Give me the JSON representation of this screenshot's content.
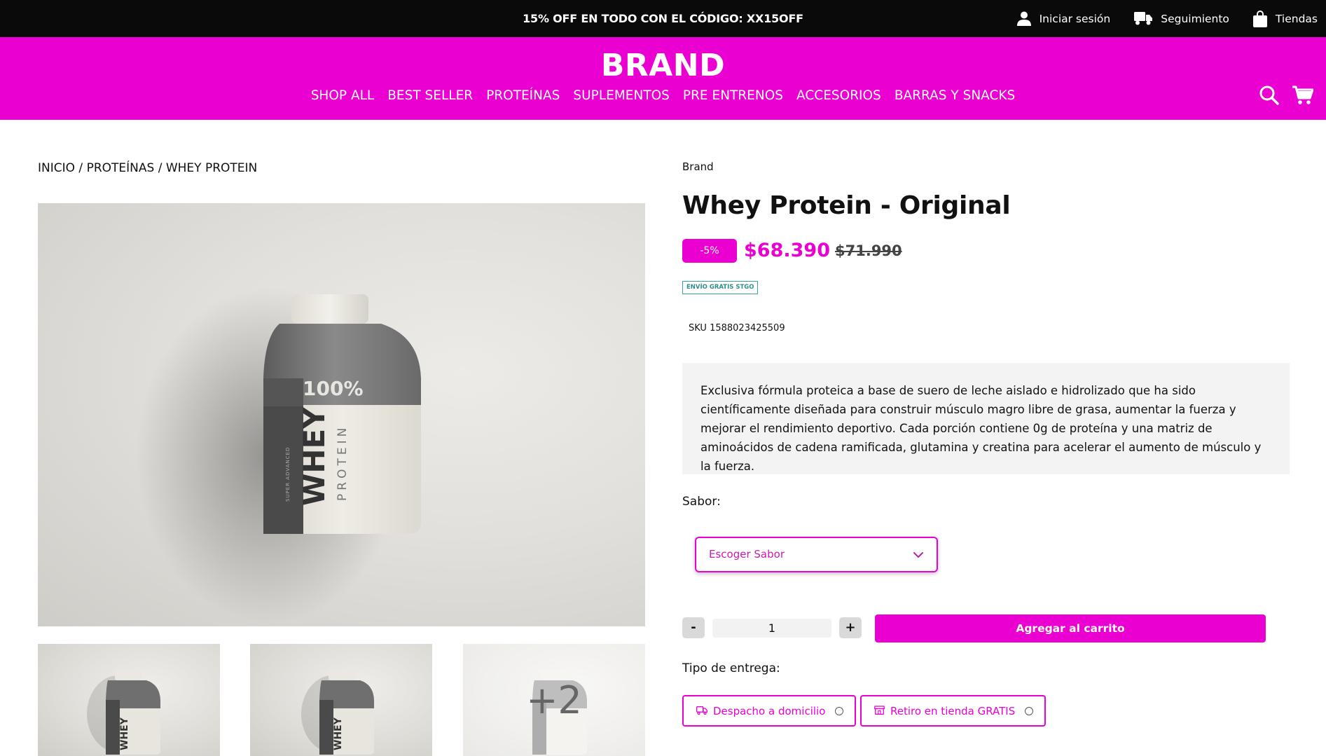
{
  "topbar": {
    "promo": "15% OFF EN TODO CON EL CÓDIGO: XX15OFF",
    "links": [
      {
        "label": "Iniciar sesión",
        "icon": "user-icon"
      },
      {
        "label": "Seguimiento",
        "icon": "truck-icon"
      },
      {
        "label": "Tiendas",
        "icon": "shopping-bag-icon"
      }
    ]
  },
  "header": {
    "logo": "BRAND",
    "nav": [
      "SHOP ALL",
      "BEST SELLER",
      "PROTEÍNAS",
      "SUPLEMENTOS",
      "PRE ENTRENOS",
      "ACCESORIOS",
      "BARRAS Y SNACKS"
    ],
    "icons": [
      "search-icon",
      "cart-icon"
    ]
  },
  "breadcrumb": {
    "items": [
      "INICIO",
      "PROTEÍNAS",
      "WHEY PROTEIN"
    ],
    "separator": " / "
  },
  "gallery": {
    "jar_text": {
      "percent": "100%",
      "word": "WHEY",
      "sub": "PROTEIN",
      "tag": "SUPER ADVANCED"
    },
    "more_count": "+2"
  },
  "product": {
    "brand": "Brand",
    "title": "Whey Protein - Original",
    "discount": "-5%",
    "price": "$68.390",
    "old_price": "$71.990",
    "shipping_badge": "ENVÍO GRATIS STGO",
    "sku": "SKU 1588023425509",
    "description": "Exclusiva fórmula proteica a base de suero de leche aislado e hidrolizado que ha sido científicamente diseñada para construir músculo magro libre de grasa, aumentar la fuerza y mejorar el rendimiento deportivo. Cada porción contiene 0g de proteína y una matriz de aminoácidos de cadena ramificada, glutamina y creatina para acelerar el aumento de músculo y la fuerza."
  },
  "options": {
    "flavor_label": "Sabor:",
    "flavor_placeholder": "Escoger Sabor",
    "quantity": "1",
    "minus": "-",
    "plus": "+",
    "add_to_cart": "Agregar al carrito",
    "delivery_label": "Tipo de entrega:",
    "delivery_options": [
      "Despacho a domicilio",
      "Retiro en tienda GRATIS"
    ]
  },
  "colors": {
    "brand": "#ea00d1",
    "topbar": "#0a0a0a",
    "badge": "#3aa59a"
  }
}
